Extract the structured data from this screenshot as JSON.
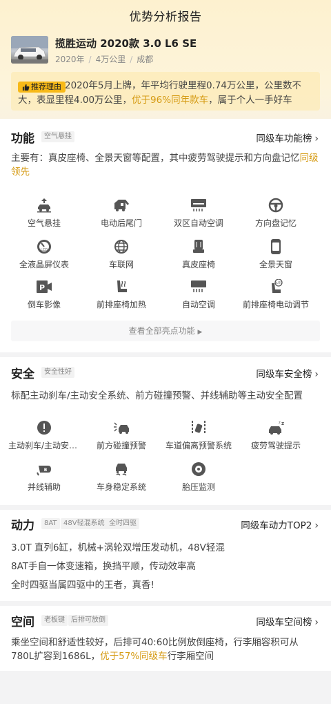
{
  "header": {
    "title": "优势分析报告",
    "car_name": "揽胜运动 2020款 3.0 L6 SE",
    "meta": [
      "2020年",
      "4万公里",
      "成都"
    ]
  },
  "reason": {
    "tag": "推荐理由",
    "text_part1": "2020年5月上牌，年平均行驶里程0.74万公里，公里数不大，表显里程4.00万公里，",
    "text_highlight": "优于96%同年款车",
    "text_part2": "，属于个人一手好车"
  },
  "function_section": {
    "title": "功能",
    "tag": "空气悬挂",
    "rank": "同级车功能榜",
    "desc_part1": "主要有：真皮座椅、全景天窗等配置，其中疲劳驾驶提示和方向盘记忆",
    "desc_highlight": "同级领先",
    "features": [
      {
        "label": "空气悬挂",
        "icon": "air-suspension-icon"
      },
      {
        "label": "电动后尾门",
        "icon": "power-tailgate-icon"
      },
      {
        "label": "双区自动空调",
        "icon": "dual-zone-ac-icon"
      },
      {
        "label": "方向盘记忆",
        "icon": "steering-wheel-icon"
      },
      {
        "label": "全液晶屏仪表",
        "icon": "lcd-cluster-icon"
      },
      {
        "label": "车联网",
        "icon": "connected-car-icon"
      },
      {
        "label": "真皮座椅",
        "icon": "leather-seat-icon"
      },
      {
        "label": "全景天窗",
        "icon": "panoramic-sunroof-icon"
      },
      {
        "label": "倒车影像",
        "icon": "reverse-camera-icon"
      },
      {
        "label": "前排座椅加热",
        "icon": "seat-heating-icon"
      },
      {
        "label": "自动空调",
        "icon": "auto-ac-icon"
      },
      {
        "label": "前排座椅电动调节",
        "icon": "power-seat-icon"
      }
    ],
    "view_all": "查看全部亮点功能"
  },
  "safety_section": {
    "title": "安全",
    "tag": "安全性好",
    "rank": "同级车安全榜",
    "desc": "标配主动刹车/主动安全系统、前方碰撞预警、并线辅助等主动安全配置",
    "features": [
      {
        "label": "主动刹车/主动安全系统",
        "icon": "active-brake-icon"
      },
      {
        "label": "前方碰撞预警",
        "icon": "collision-warning-icon"
      },
      {
        "label": "车道偏离预警系统",
        "icon": "lane-departure-icon"
      },
      {
        "label": "疲劳驾驶提示",
        "icon": "fatigue-alert-icon"
      },
      {
        "label": "并线辅助",
        "icon": "blind-spot-icon"
      },
      {
        "label": "车身稳定系统",
        "icon": "stability-control-icon"
      },
      {
        "label": "胎压监测",
        "icon": "tire-pressure-icon"
      }
    ]
  },
  "power_section": {
    "title": "动力",
    "tags": [
      "8AT",
      "48V轻混系统",
      "全时四驱"
    ],
    "rank": "同级车动力TOP2",
    "lines": [
      "3.0T 直列6缸，机械+涡轮双增压发动机，48V轻混",
      "8AT手自一体变速箱，换挡平顺，传动效率高",
      "全时四驱当属四驱中的王者，真香!"
    ]
  },
  "space_section": {
    "title": "空间",
    "tags": [
      "老板键",
      "后排可放倒"
    ],
    "rank": "同级车空间榜",
    "desc_part1": "乘坐空间和舒适性较好，后排可40:60比例放倒座椅，行李厢容积可从780L扩容到1686L，",
    "desc_highlight": "优于57%同级车",
    "desc_part2": "行李厢空间"
  },
  "colors": {
    "accent": "#d59a12",
    "tag_yellow": "#f7b918",
    "icon_gray": "#555555"
  }
}
